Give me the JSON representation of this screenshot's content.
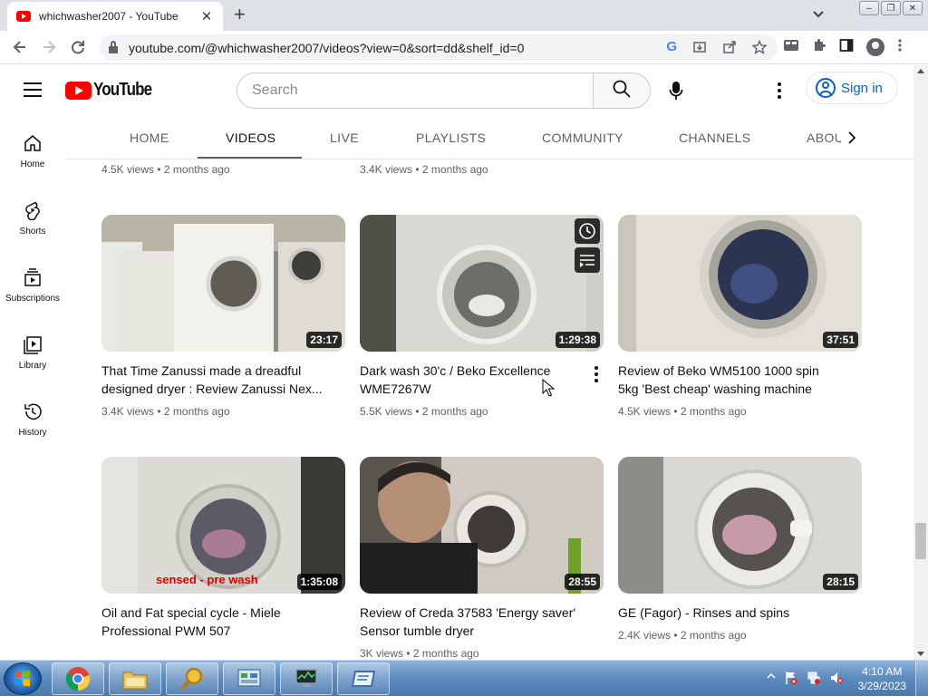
{
  "browser": {
    "tab_title": "whichwasher2007 - YouTube",
    "url": "youtube.com/@whichwasher2007/videos?view=0&sort=dd&shelf_id=0",
    "new_tab": "+",
    "close_tab": "✕",
    "window_controls": [
      "–",
      "❐",
      "✕"
    ]
  },
  "masthead": {
    "logo_text": "YouTube",
    "search_placeholder": "Search",
    "signin_label": "Sign in"
  },
  "guide": [
    {
      "label": "Home",
      "icon": "home-icon"
    },
    {
      "label": "Shorts",
      "icon": "shorts-icon"
    },
    {
      "label": "Subscriptions",
      "icon": "subscriptions-icon"
    },
    {
      "label": "Library",
      "icon": "library-icon"
    },
    {
      "label": "History",
      "icon": "history-icon"
    }
  ],
  "channel_tabs": [
    "HOME",
    "VIDEOS",
    "LIVE",
    "PLAYLISTS",
    "COMMUNITY",
    "CHANNELS",
    "ABOUT"
  ],
  "active_tab": "VIDEOS",
  "top_row_partial": [
    {
      "meta": "4.5K views • 2 months ago"
    },
    {
      "meta": "3.4K views • 2 months ago"
    }
  ],
  "videos": [
    {
      "title": "That Time Zanussi made a dreadful designed dryer : Review Zanussi Nex...",
      "duration": "23:17",
      "meta": "3.4K views • 2 months ago"
    },
    {
      "title": "Dark wash 30'c / Beko Excellence WME7267W",
      "duration": "1:29:38",
      "meta": "5.5K views • 2 months ago"
    },
    {
      "title": "Review of Beko WM5100 1000 spin 5kg 'Best cheap' washing machine",
      "duration": "37:51",
      "meta": "4.5K views • 2 months ago"
    },
    {
      "title": "Oil and Fat special cycle - Miele Professional PWM 507",
      "duration": "1:35:08",
      "meta": "",
      "overlay_text": "sensed - pre wash"
    },
    {
      "title": "Review of Creda 37583 'Energy saver' Sensor tumble dryer",
      "duration": "28:55",
      "meta": "3K views • 2 months ago"
    },
    {
      "title": "GE (Fagor) - Rinses and spins",
      "duration": "28:15",
      "meta": "2.4K views • 2 months ago"
    }
  ],
  "taskbar": {
    "time": "4:10 AM",
    "date": "3/29/2023"
  },
  "colors": {
    "youtube_red": "#ff0000",
    "signin_blue": "#065fd4",
    "taskbar_blue": "#5f8dc0"
  }
}
